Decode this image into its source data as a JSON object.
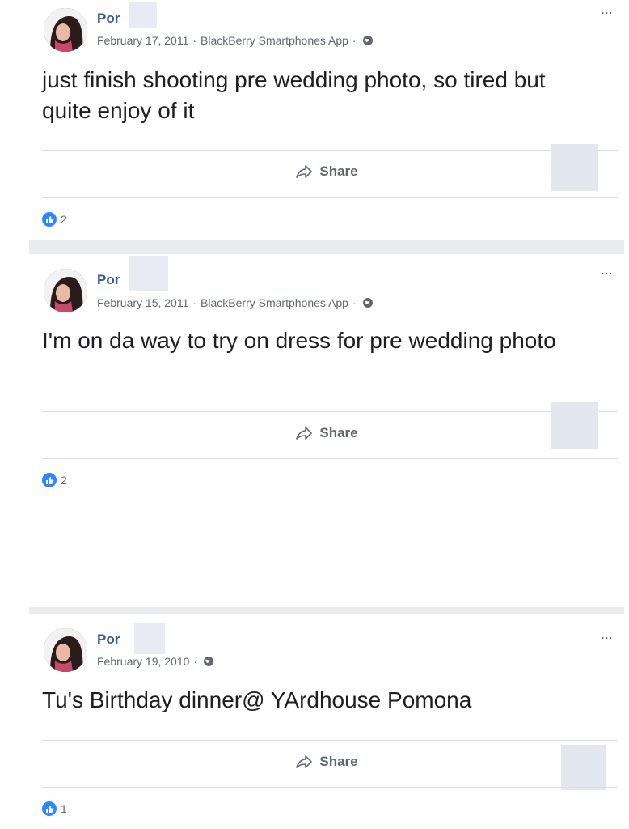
{
  "posts": [
    {
      "author": "Por",
      "date": "February 17, 2011",
      "app": "BlackBerry Smartphones App",
      "text": "just finish shooting pre wedding photo, so tired but quite enjoy of it",
      "share_label": "Share",
      "like_count": "2",
      "more_label": "..."
    },
    {
      "author": "Por",
      "date": "February 15, 2011",
      "app": "BlackBerry Smartphones App",
      "text": "I'm on da way to try on dress for pre wedding photo",
      "share_label": "Share",
      "like_count": "2",
      "more_label": "..."
    },
    {
      "author": "Por",
      "date": "February 19, 2010",
      "app": "",
      "text": "Tu's Birthday dinner@ YArdhouse Pomona",
      "share_label": "Share",
      "like_count": "1",
      "more_label": "..."
    }
  ],
  "meta_separator": "·",
  "icons": {
    "audience": "globe-icon",
    "share": "share-arrow-icon",
    "like": "thumbs-up-icon",
    "more": "more-options-icon"
  },
  "colors": {
    "author": "#385898",
    "like_badge": "#2d88ff",
    "meta": "#606770"
  }
}
